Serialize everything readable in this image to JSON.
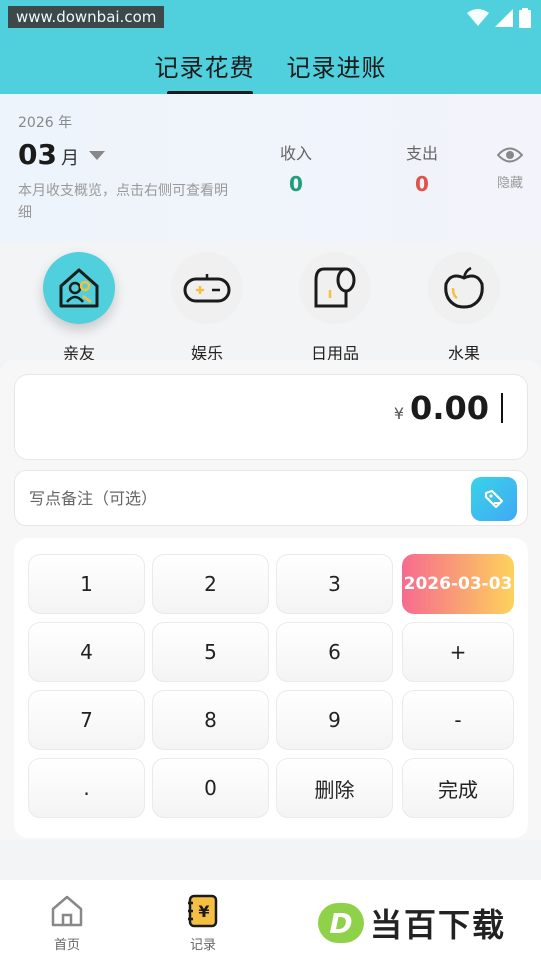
{
  "header": {
    "watermark": "www.downbai.com",
    "tabs": [
      {
        "label": "记录花费",
        "active": true
      },
      {
        "label": "记录进账",
        "active": false
      }
    ]
  },
  "summary": {
    "year": "2026 年",
    "month": "03",
    "month_unit": "月",
    "description": "本月收支概览，点击右侧可查看明细",
    "income_label": "收入",
    "income_value": "0",
    "income_color": "#1e9e7a",
    "expense_label": "支出",
    "expense_value": "0",
    "expense_color": "#e2524a",
    "hide_label": "隐藏"
  },
  "categories": [
    {
      "label": "亲友",
      "icon": "home-people-icon",
      "active": true
    },
    {
      "label": "娱乐",
      "icon": "gamepad-icon",
      "active": false
    },
    {
      "label": "日用品",
      "icon": "toilet-paper-icon",
      "active": false
    },
    {
      "label": "水果",
      "icon": "apple-icon",
      "active": false
    }
  ],
  "amount": {
    "currency": "¥",
    "value": "0.00"
  },
  "note": {
    "placeholder": "写点备注（可选）"
  },
  "keypad": {
    "keys": [
      "1",
      "2",
      "3",
      "7",
      "8",
      "9",
      "4",
      "5",
      "6",
      ".",
      "0"
    ],
    "date": "2026-03-03",
    "plus": "+",
    "minus": "-",
    "delete": "删除",
    "done": "完成"
  },
  "bottom_nav": {
    "items": [
      {
        "label": "首页",
        "icon": "home-icon"
      },
      {
        "label": "记录",
        "icon": "ledger-icon"
      }
    ]
  },
  "brand_watermark": {
    "logo": "D",
    "text": "当百下载"
  },
  "colors": {
    "accent": "#4fd0dc"
  }
}
